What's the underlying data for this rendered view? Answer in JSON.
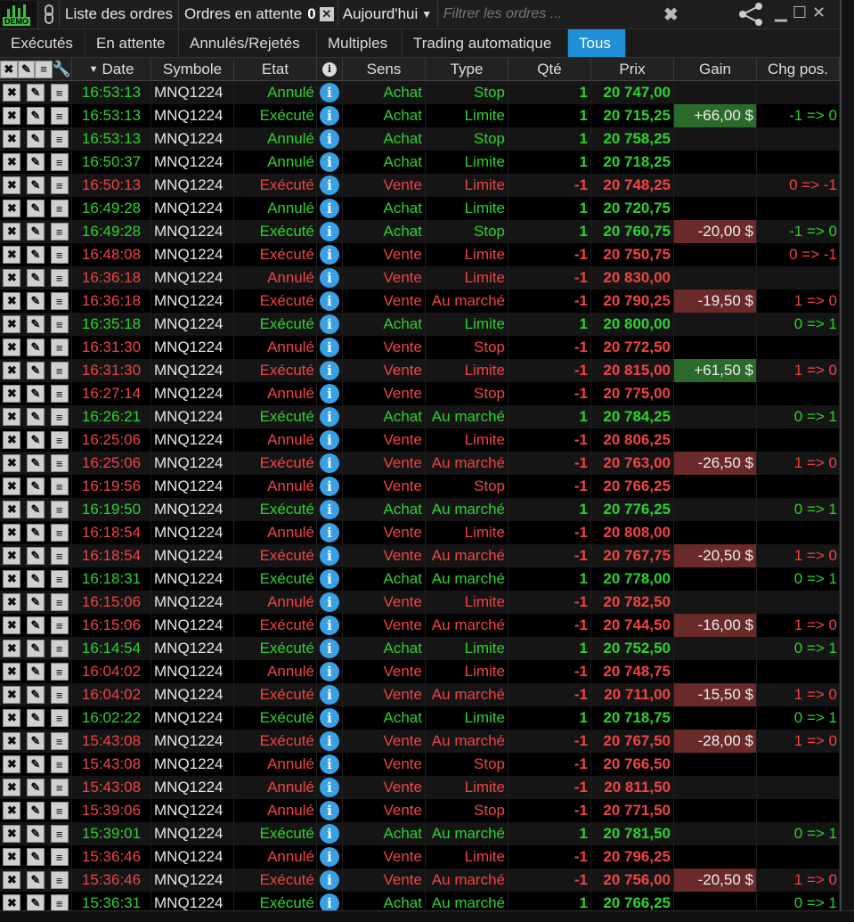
{
  "toolbar": {
    "demo_label": "DEMO",
    "list_title": "Liste des ordres",
    "pending_label": "Ordres en attente",
    "pending_count": "0",
    "period": "Aujourd'hui",
    "filter_placeholder": "Filtrer les ordres ..."
  },
  "tabs": [
    "Exécutés",
    "En attente",
    "Annulés/Rejetés",
    "Multiples",
    "Trading automatique",
    "Tous"
  ],
  "active_tab": "Tous",
  "headers": {
    "date": "Date",
    "symbole": "Symbole",
    "etat": "Etat",
    "sens": "Sens",
    "type": "Type",
    "qte": "Qté",
    "prix": "Prix",
    "gain": "Gain",
    "chg_pos": "Chg pos."
  },
  "colors": {
    "green": "#2ed22e",
    "red": "#f04444",
    "accent": "#1f8fd8",
    "gain_pos_bg": "#2b6a2b",
    "gain_neg_bg": "#6a2a2a"
  },
  "rows": [
    {
      "date": "16:53:13",
      "symbole": "MNQ1224",
      "etat": "Annulé",
      "sens": "Achat",
      "type": "Stop",
      "qte": "1",
      "prix": "20 747,00",
      "gain": "",
      "chg": "",
      "c": "g"
    },
    {
      "date": "16:53:13",
      "symbole": "MNQ1224",
      "etat": "Exécuté",
      "sens": "Achat",
      "type": "Limite",
      "qte": "1",
      "prix": "20 715,25",
      "gain": "+66,00 $",
      "chg": "-1 => 0",
      "c": "g"
    },
    {
      "date": "16:53:13",
      "symbole": "MNQ1224",
      "etat": "Annulé",
      "sens": "Achat",
      "type": "Stop",
      "qte": "1",
      "prix": "20 758,25",
      "gain": "",
      "chg": "",
      "c": "g"
    },
    {
      "date": "16:50:37",
      "symbole": "MNQ1224",
      "etat": "Annulé",
      "sens": "Achat",
      "type": "Limite",
      "qte": "1",
      "prix": "20 718,25",
      "gain": "",
      "chg": "",
      "c": "g"
    },
    {
      "date": "16:50:13",
      "symbole": "MNQ1224",
      "etat": "Exécuté",
      "sens": "Vente",
      "type": "Limite",
      "qte": "-1",
      "prix": "20 748,25",
      "gain": "",
      "chg": "0 => -1",
      "c": "r"
    },
    {
      "date": "16:49:28",
      "symbole": "MNQ1224",
      "etat": "Annulé",
      "sens": "Achat",
      "type": "Limite",
      "qte": "1",
      "prix": "20 720,75",
      "gain": "",
      "chg": "",
      "c": "g"
    },
    {
      "date": "16:49:28",
      "symbole": "MNQ1224",
      "etat": "Exécuté",
      "sens": "Achat",
      "type": "Stop",
      "qte": "1",
      "prix": "20 760,75",
      "gain": "-20,00 $",
      "chg": "-1 => 0",
      "c": "g"
    },
    {
      "date": "16:48:08",
      "symbole": "MNQ1224",
      "etat": "Exécuté",
      "sens": "Vente",
      "type": "Limite",
      "qte": "-1",
      "prix": "20 750,75",
      "gain": "",
      "chg": "0 => -1",
      "c": "r"
    },
    {
      "date": "16:36:18",
      "symbole": "MNQ1224",
      "etat": "Annulé",
      "sens": "Vente",
      "type": "Limite",
      "qte": "-1",
      "prix": "20 830,00",
      "gain": "",
      "chg": "",
      "c": "r"
    },
    {
      "date": "16:36:18",
      "symbole": "MNQ1224",
      "etat": "Exécuté",
      "sens": "Vente",
      "type": "Au marché",
      "qte": "-1",
      "prix": "20 790,25",
      "gain": "-19,50 $",
      "chg": "1 => 0",
      "c": "r"
    },
    {
      "date": "16:35:18",
      "symbole": "MNQ1224",
      "etat": "Exécuté",
      "sens": "Achat",
      "type": "Limite",
      "qte": "1",
      "prix": "20 800,00",
      "gain": "",
      "chg": "0 => 1",
      "c": "g"
    },
    {
      "date": "16:31:30",
      "symbole": "MNQ1224",
      "etat": "Annulé",
      "sens": "Vente",
      "type": "Stop",
      "qte": "-1",
      "prix": "20 772,50",
      "gain": "",
      "chg": "",
      "c": "r"
    },
    {
      "date": "16:31:30",
      "symbole": "MNQ1224",
      "etat": "Exécuté",
      "sens": "Vente",
      "type": "Limite",
      "qte": "-1",
      "prix": "20 815,00",
      "gain": "+61,50 $",
      "chg": "1 => 0",
      "c": "r"
    },
    {
      "date": "16:27:14",
      "symbole": "MNQ1224",
      "etat": "Annulé",
      "sens": "Vente",
      "type": "Stop",
      "qte": "-1",
      "prix": "20 775,00",
      "gain": "",
      "chg": "",
      "c": "r"
    },
    {
      "date": "16:26:21",
      "symbole": "MNQ1224",
      "etat": "Exécuté",
      "sens": "Achat",
      "type": "Au marché",
      "qte": "1",
      "prix": "20 784,25",
      "gain": "",
      "chg": "0 => 1",
      "c": "g"
    },
    {
      "date": "16:25:06",
      "symbole": "MNQ1224",
      "etat": "Annulé",
      "sens": "Vente",
      "type": "Limite",
      "qte": "-1",
      "prix": "20 806,25",
      "gain": "",
      "chg": "",
      "c": "r"
    },
    {
      "date": "16:25:06",
      "symbole": "MNQ1224",
      "etat": "Exécuté",
      "sens": "Vente",
      "type": "Au marché",
      "qte": "-1",
      "prix": "20 763,00",
      "gain": "-26,50 $",
      "chg": "1 => 0",
      "c": "r"
    },
    {
      "date": "16:19:56",
      "symbole": "MNQ1224",
      "etat": "Annulé",
      "sens": "Vente",
      "type": "Stop",
      "qte": "-1",
      "prix": "20 766,25",
      "gain": "",
      "chg": "",
      "c": "r"
    },
    {
      "date": "16:19:50",
      "symbole": "MNQ1224",
      "etat": "Exécuté",
      "sens": "Achat",
      "type": "Au marché",
      "qte": "1",
      "prix": "20 776,25",
      "gain": "",
      "chg": "0 => 1",
      "c": "g"
    },
    {
      "date": "16:18:54",
      "symbole": "MNQ1224",
      "etat": "Annulé",
      "sens": "Vente",
      "type": "Limite",
      "qte": "-1",
      "prix": "20 808,00",
      "gain": "",
      "chg": "",
      "c": "r"
    },
    {
      "date": "16:18:54",
      "symbole": "MNQ1224",
      "etat": "Exécuté",
      "sens": "Vente",
      "type": "Au marché",
      "qte": "-1",
      "prix": "20 767,75",
      "gain": "-20,50 $",
      "chg": "1 => 0",
      "c": "r"
    },
    {
      "date": "16:18:31",
      "symbole": "MNQ1224",
      "etat": "Exécuté",
      "sens": "Achat",
      "type": "Au marché",
      "qte": "1",
      "prix": "20 778,00",
      "gain": "",
      "chg": "0 => 1",
      "c": "g"
    },
    {
      "date": "16:15:06",
      "symbole": "MNQ1224",
      "etat": "Annulé",
      "sens": "Vente",
      "type": "Limite",
      "qte": "-1",
      "prix": "20 782,50",
      "gain": "",
      "chg": "",
      "c": "r"
    },
    {
      "date": "16:15:06",
      "symbole": "MNQ1224",
      "etat": "Exécuté",
      "sens": "Vente",
      "type": "Au marché",
      "qte": "-1",
      "prix": "20 744,50",
      "gain": "-16,00 $",
      "chg": "1 => 0",
      "c": "r"
    },
    {
      "date": "16:14:54",
      "symbole": "MNQ1224",
      "etat": "Exécuté",
      "sens": "Achat",
      "type": "Limite",
      "qte": "1",
      "prix": "20 752,50",
      "gain": "",
      "chg": "0 => 1",
      "c": "g"
    },
    {
      "date": "16:04:02",
      "symbole": "MNQ1224",
      "etat": "Annulé",
      "sens": "Vente",
      "type": "Limite",
      "qte": "-1",
      "prix": "20 748,75",
      "gain": "",
      "chg": "",
      "c": "r"
    },
    {
      "date": "16:04:02",
      "symbole": "MNQ1224",
      "etat": "Exécuté",
      "sens": "Vente",
      "type": "Au marché",
      "qte": "-1",
      "prix": "20 711,00",
      "gain": "-15,50 $",
      "chg": "1 => 0",
      "c": "r"
    },
    {
      "date": "16:02:22",
      "symbole": "MNQ1224",
      "etat": "Exécuté",
      "sens": "Achat",
      "type": "Limite",
      "qte": "1",
      "prix": "20 718,75",
      "gain": "",
      "chg": "0 => 1",
      "c": "g"
    },
    {
      "date": "15:43:08",
      "symbole": "MNQ1224",
      "etat": "Exécuté",
      "sens": "Vente",
      "type": "Au marché",
      "qte": "-1",
      "prix": "20 767,50",
      "gain": "-28,00 $",
      "chg": "1 => 0",
      "c": "r"
    },
    {
      "date": "15:43:08",
      "symbole": "MNQ1224",
      "etat": "Annulé",
      "sens": "Vente",
      "type": "Stop",
      "qte": "-1",
      "prix": "20 766,50",
      "gain": "",
      "chg": "",
      "c": "r"
    },
    {
      "date": "15:43:08",
      "symbole": "MNQ1224",
      "etat": "Annulé",
      "sens": "Vente",
      "type": "Limite",
      "qte": "-1",
      "prix": "20 811,50",
      "gain": "",
      "chg": "",
      "c": "r"
    },
    {
      "date": "15:39:06",
      "symbole": "MNQ1224",
      "etat": "Annulé",
      "sens": "Vente",
      "type": "Stop",
      "qte": "-1",
      "prix": "20 771,50",
      "gain": "",
      "chg": "",
      "c": "r"
    },
    {
      "date": "15:39:01",
      "symbole": "MNQ1224",
      "etat": "Exécuté",
      "sens": "Achat",
      "type": "Au marché",
      "qte": "1",
      "prix": "20 781,50",
      "gain": "",
      "chg": "0 => 1",
      "c": "g"
    },
    {
      "date": "15:36:46",
      "symbole": "MNQ1224",
      "etat": "Annulé",
      "sens": "Vente",
      "type": "Limite",
      "qte": "-1",
      "prix": "20 796,25",
      "gain": "",
      "chg": "",
      "c": "r"
    },
    {
      "date": "15:36:46",
      "symbole": "MNQ1224",
      "etat": "Exécuté",
      "sens": "Vente",
      "type": "Au marché",
      "qte": "-1",
      "prix": "20 756,00",
      "gain": "-20,50 $",
      "chg": "1 => 0",
      "c": "r"
    },
    {
      "date": "15:36:31",
      "symbole": "MNQ1224",
      "etat": "Exécuté",
      "sens": "Achat",
      "type": "Au marché",
      "qte": "1",
      "prix": "20 766,25",
      "gain": "",
      "chg": "0 => 1",
      "c": "g"
    }
  ]
}
